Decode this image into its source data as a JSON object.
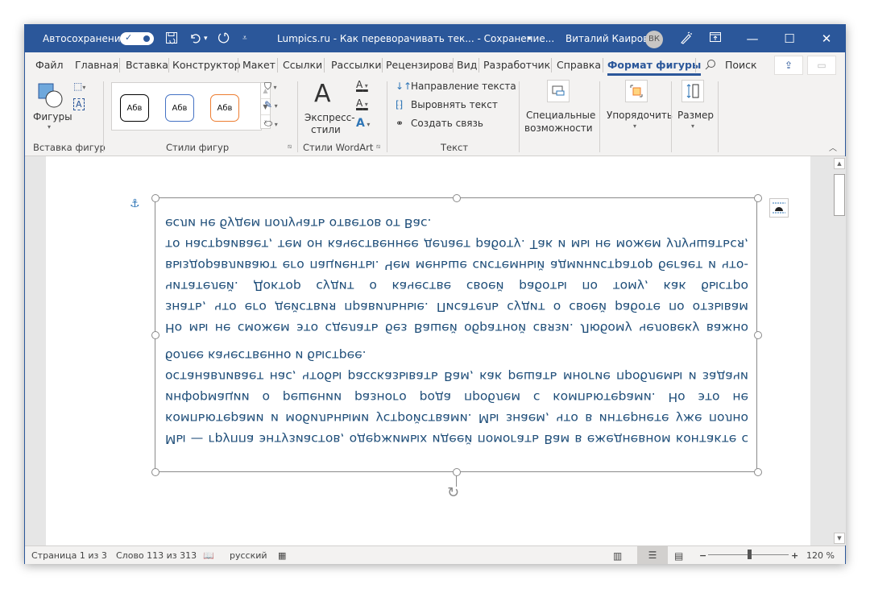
{
  "titlebar": {
    "autosave_label": "Автосохранение",
    "autosave_on": true,
    "doc_title": "Lumpics.ru - Как переворачивать тек...  -  Сохранение...",
    "title_dropdown": "▾",
    "user_name": "Виталий Каиров",
    "user_initials": "ВК",
    "icons": {
      "save": "save-icon",
      "undo": "undo-icon",
      "redo": "redo-icon",
      "customize": "customize-qat-icon",
      "pen": "pen-icon",
      "ribbon_display": "ribbon-display-icon"
    },
    "minimize": "—",
    "maximize": "☐",
    "close": "✕"
  },
  "tabs": [
    {
      "label": "Файл"
    },
    {
      "label": "Главная"
    },
    {
      "label": "Вставка"
    },
    {
      "label": "Конструктор"
    },
    {
      "label": "Макет"
    },
    {
      "label": "Ссылки"
    },
    {
      "label": "Рассылки"
    },
    {
      "label": "Рецензирова"
    },
    {
      "label": "Вид"
    },
    {
      "label": "Разработчик"
    },
    {
      "label": "Справка"
    },
    {
      "label": "Формат фигуры",
      "active": true
    }
  ],
  "search": {
    "label": "Поиск"
  },
  "ribbon": {
    "insert_shapes": {
      "shapes_label": "Фигуры",
      "group_label": "Вставка фигур"
    },
    "shape_styles": {
      "samples": [
        "Абв",
        "Абв",
        "Абв"
      ],
      "sample_colors": [
        "#000000",
        "#4472c4",
        "#ed7d31"
      ],
      "group_label": "Стили фигур"
    },
    "wordart": {
      "express_label_1": "Экспресс-",
      "express_label_2": "стили",
      "group_label": "Стили WordArt"
    },
    "text": {
      "direction": "Направление текста",
      "align": "Выровнять текст",
      "link": "Создать связь",
      "group_label": "Текст"
    },
    "accessibility": {
      "label_1": "Специальные",
      "label_2": "возможности"
    },
    "arrange": {
      "label": "Упорядочить"
    },
    "size": {
      "label": "Размер"
    }
  },
  "document": {
    "paragraphs": [
      "Мы — группа энтузиастов, одержимых идеей помогать Вам в ежедневном контакте с компьютерами и мобильными устройствами. Мы знаем, что в интернете уже полно информации о решении разного рода проблем с компьютерами. Но это не останавливает нас, чтобы рассказывать Вам, как решать многие проблемы и задачи более качественно и быстрее.",
      "Но мы не сможем это сделать без Вашей обратной связи. Любому человеку важно знать, что его действия правильные. Писатель судит о своей работе по отзывам читателей. Доктор судит о качестве своей работы по тому, как быстро выздоравливают его пациенты. Чем меньше системный администратор бегает и что-то настраивает, тем он качественнее делает работу. Так и мы не можем улучшаться, если не будем получать ответов от Вас."
    ],
    "text_color": "#1f4e79",
    "text_flipped": true
  },
  "statusbar": {
    "page": "Страница 1 из 3",
    "words": "Слово 113 из 313",
    "language": "русский",
    "zoom_percent": "120 %",
    "zoom_value": 120
  },
  "colors": {
    "accent": "#2b579a"
  }
}
